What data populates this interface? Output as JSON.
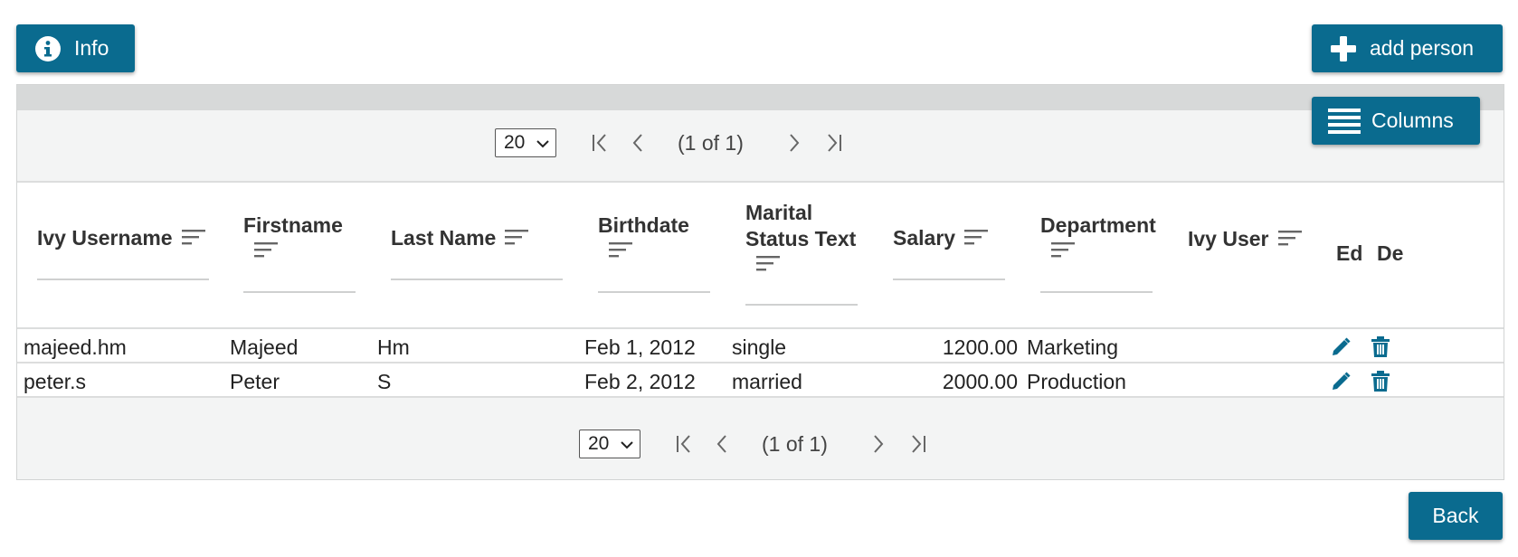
{
  "toolbar": {
    "info_label": "Info",
    "add_person_label": "add person",
    "columns_label": "Columns",
    "back_label": "Back"
  },
  "paginator": {
    "rows_per_page": "20",
    "report": "(1 of 1)"
  },
  "columns": {
    "ivy_username": "Ivy Username",
    "firstname": "Firstname",
    "last_name": "Last Name",
    "birthdate": "Birthdate",
    "marital_line1": "Marital",
    "marital_line2": "Status Text",
    "salary": "Salary",
    "department": "Department",
    "ivy_user": "Ivy User",
    "edit": "Ed",
    "delete": "De"
  },
  "rows": [
    {
      "username": "majeed.hm",
      "firstname": "Majeed",
      "last_name": "Hm",
      "birthdate": "Feb 1, 2012",
      "marital": "single",
      "salary": "1200.00",
      "department": "Marketing"
    },
    {
      "username": "peter.s",
      "firstname": "Peter",
      "last_name": "S",
      "birthdate": "Feb 2, 2012",
      "marital": "married",
      "salary": "2000.00",
      "department": "Production"
    }
  ],
  "colors": {
    "primary": "#0a6b8f",
    "panel_bg": "#f3f4f4",
    "header_strip": "#d7d9d9"
  },
  "icons": [
    "info-circle-icon",
    "plus-icon",
    "bars-icon",
    "chevron-down-icon",
    "page-first-icon",
    "page-prev-icon",
    "page-next-icon",
    "page-last-icon",
    "sort-icon",
    "pencil-icon",
    "trash-icon"
  ]
}
